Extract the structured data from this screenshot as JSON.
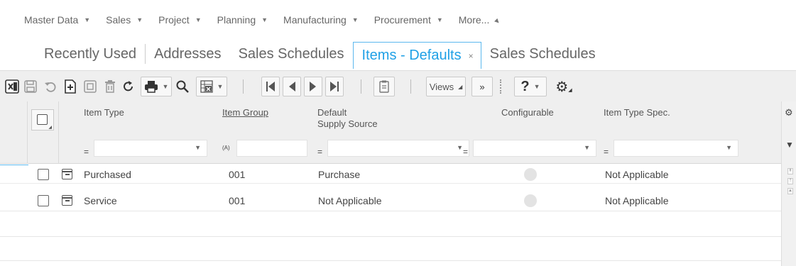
{
  "menu": {
    "items": [
      {
        "label": "Master Data"
      },
      {
        "label": "Sales"
      },
      {
        "label": "Project"
      },
      {
        "label": "Planning"
      },
      {
        "label": "Manufacturing"
      },
      {
        "label": "Procurement"
      },
      {
        "label": "More..."
      }
    ]
  },
  "tabs": [
    {
      "label": "Recently Used"
    },
    {
      "label": "Addresses"
    },
    {
      "label": "Sales Schedules"
    },
    {
      "label": "Items - Defaults",
      "active": true,
      "close": "×"
    },
    {
      "label": "Sales Schedules"
    }
  ],
  "toolbar": {
    "views_label": "Views",
    "more_label": "»",
    "help_label": "?"
  },
  "grid": {
    "columns": {
      "item_type": "Item Type",
      "item_group": "Item Group",
      "default_supply_source_1": "Default",
      "default_supply_source_2": "Supply Source",
      "configurable": "Configurable",
      "item_type_spec": "Item Type Spec."
    },
    "filters": {
      "eq": "=",
      "text_op": "(A)"
    },
    "rows": [
      {
        "item_type": "Purchased",
        "item_group": "001",
        "supply_source": "Purchase",
        "item_type_spec": "Not Applicable"
      },
      {
        "item_type": "Service",
        "item_group": "001",
        "supply_source": "Not Applicable",
        "item_type_spec": "Not Applicable"
      }
    ]
  },
  "colors": {
    "accent": "#1fa0e6",
    "toolbar_bg": "#efefef"
  }
}
